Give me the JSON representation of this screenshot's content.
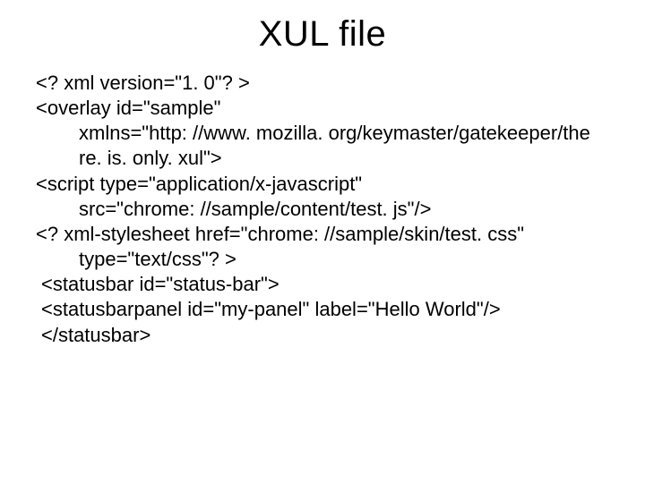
{
  "title": "XUL file",
  "lines": {
    "l1": "<? xml version=\"1. 0\"? >",
    "l2": "<overlay id=\"sample\"",
    "l3": "xmlns=\"http: //www. mozilla. org/keymaster/gatekeeper/the",
    "l4": "re. is. only. xul\">",
    "l5": "<script type=\"application/x-javascript\"",
    "l6": "src=\"chrome: //sample/content/test. js\"/>",
    "l7": "<? xml-stylesheet href=\"chrome: //sample/skin/test. css\"",
    "l8": "type=\"text/css\"? >",
    "l9": "<statusbar id=\"status-bar\">",
    "l10": "<statusbarpanel id=\"my-panel\" label=\"Hello World\"/>",
    "l11": "</statusbar>"
  }
}
